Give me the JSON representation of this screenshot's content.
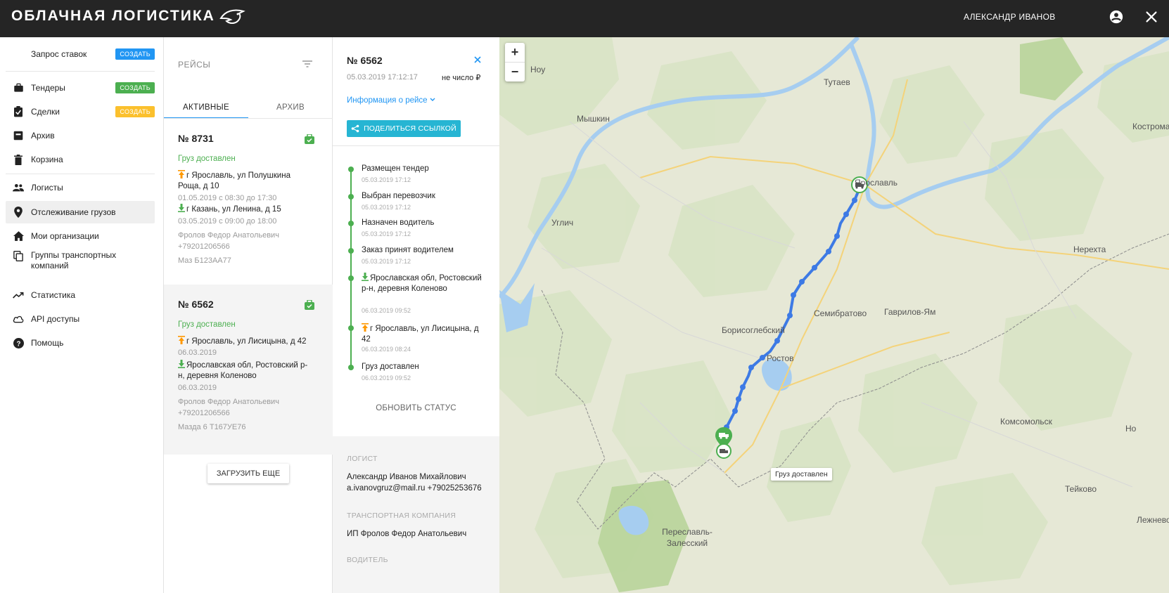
{
  "header": {
    "brand": "ОБЛАЧНАЯ ЛОГИСТИКА",
    "user_name": "АЛЕКСАНДР ИВАНОВ"
  },
  "sidebar": {
    "items": [
      {
        "label": "Запрос ставок",
        "icon": "none",
        "badge": "СОЗДАТЬ",
        "badge_color": "#2196f3"
      },
      {
        "label": "Тендеры",
        "icon": "briefcase-icon",
        "badge": "СОЗДАТЬ",
        "badge_color": "#4caf50"
      },
      {
        "label": "Сделки",
        "icon": "clipboard-check-icon",
        "badge": "СОЗДАТЬ",
        "badge_color": "#fbc02d"
      },
      {
        "label": "Архив",
        "icon": "archive-icon"
      },
      {
        "label": "Корзина",
        "icon": "trash-icon"
      },
      {
        "label": "Логисты",
        "icon": "people-icon"
      },
      {
        "label": "Отслеживание грузов",
        "icon": "map-pin-icon",
        "active": true
      },
      {
        "label": "Мои организации",
        "icon": "home-icon"
      },
      {
        "label": "Группы транспортных компаний",
        "icon": "copy-icon"
      },
      {
        "label": "Статистика",
        "icon": "trending-up-icon"
      },
      {
        "label": "API доступы",
        "icon": "cloud-icon"
      },
      {
        "label": "Помощь",
        "icon": "help-circle-icon"
      }
    ]
  },
  "trips": {
    "title": "РЕЙСЫ",
    "tabs": [
      "АКТИВНЫЕ",
      "АРХИВ"
    ],
    "cards": [
      {
        "number": "№ 8731",
        "status": "Груз доставлен",
        "from": "г Ярославль, ул Полушкина Роща, д 10",
        "from_time": "01.05.2019 с 08:30 до 17:30",
        "to": "г Казань, ул Ленина, д 15",
        "to_time": "03.05.2019 с 09:00 до 18:00",
        "driver": "Фролов Федор Анатольевич",
        "phone": "+79201206566",
        "vehicle": "Маз Б123АА77"
      },
      {
        "number": "№ 6562",
        "status": "Груз доставлен",
        "from": "г Ярославль, ул Лисицына, д 42",
        "from_time": "06.03.2019",
        "to": "Ярославская обл, Ростовский р-н, деревня Коленово",
        "to_time": "06.03.2019",
        "driver": "Фролов Федор Анатольевич",
        "phone": "+79201206566",
        "vehicle": "Мазда 6 Т167УЕ76"
      }
    ],
    "load_more": "ЗАГРУЗИТЬ ЕЩЕ"
  },
  "detail": {
    "number": "№ 6562",
    "datetime": "05.03.2019 17:12:17",
    "price": "не число ₽",
    "info_link": "Информация о рейсе",
    "share_label": "ПОДЕЛИТЬСЯ ССЫЛКОЙ",
    "timeline": [
      {
        "title": "Размещен тендер",
        "date": "05.03.2019 17:12"
      },
      {
        "title": "Выбран перевозчик",
        "date": "05.03.2019 17:12"
      },
      {
        "title": "Назначен водитель",
        "date": "05.03.2019 17:12"
      },
      {
        "title": "Заказ принят водителем",
        "date": "05.03.2019 17:12"
      },
      {
        "title": "Ярославская обл, Ростовский р-н, деревня Коленово",
        "date": "06.03.2019 09:52",
        "icon": "download-arrow-icon"
      },
      {
        "title": "г Ярославль, ул Лисицына, д 42",
        "date": "06.03.2019 08:24",
        "icon": "upload-arrow-icon"
      },
      {
        "title": "Груз доставлен",
        "date": "06.03.2019 09:52"
      }
    ],
    "update_status": "ОБНОВИТЬ СТАТУС",
    "logist_label": "ЛОГИСТ",
    "logist_name": "Александр Иванов Михайлович",
    "logist_contact": "a.ivanovgruz@mail.ru +79025253676",
    "company_label": "ТРАНСПОРТНАЯ КОМПАНИЯ",
    "company_name": "ИП Фролов Федор Анатольевич",
    "driver_label": "ВОДИТЕЛЬ"
  },
  "map": {
    "zoom_in": "+",
    "zoom_out": "−",
    "cities": [
      "Тутаев",
      "Мышкин",
      "Ярославль",
      "Углич",
      "Нерехта",
      "Семибратово",
      "Гаврилов-Ям",
      "Борисоглебский",
      "Ростов",
      "Комсомольск",
      "Тейково",
      "Переславль-Залесский",
      "Кострома",
      "Лежнево",
      "Ноу",
      "Но"
    ],
    "popup": "Груз доставлен",
    "route_color": "#3d7ae5"
  },
  "colors": {
    "accent_blue": "#2196f3",
    "status_green": "#4caf50",
    "share_button": "#26b5d3",
    "header_bg": "#252525"
  }
}
